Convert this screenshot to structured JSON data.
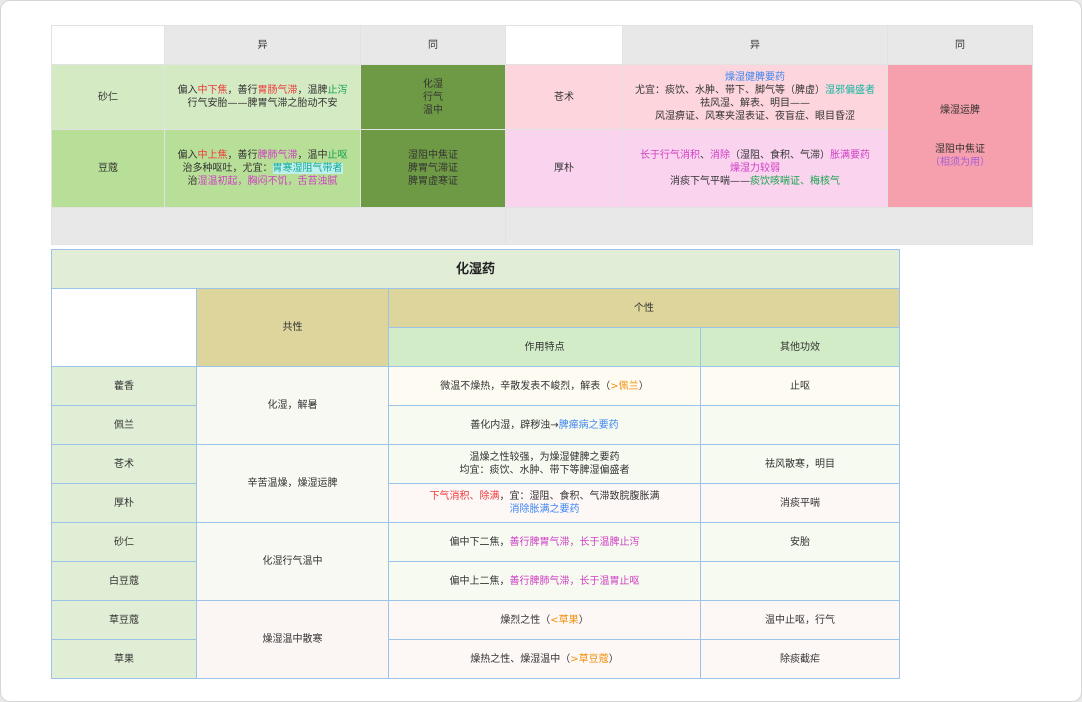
{
  "compare": {
    "header": {
      "yi": "异",
      "tong": "同"
    },
    "left": {
      "row1": {
        "name": "砂仁",
        "l1": [
          "偏入",
          "中下焦",
          "，善行",
          "胃肠气滞",
          "，温脾",
          "止泻"
        ],
        "l2": "行气安胎——脾胃气滞之胎动不安"
      },
      "row2": {
        "name": "豆蔻",
        "l1": [
          "偏入",
          "中上焦",
          "，善行",
          "脾肺气滞",
          "，温中",
          "止呕"
        ],
        "l2": [
          "治多种呕吐，尤宜：",
          "胃寒湿阻气带者"
        ],
        "l3": [
          "治",
          "湿温初起，胸闷不饥，舌苔浊腻"
        ]
      },
      "same1": [
        "化湿",
        "行气",
        "温中"
      ],
      "same2": [
        "湿阻中焦证",
        "脾胃气滞证",
        "脾胃虚寒证"
      ]
    },
    "right": {
      "row1": {
        "name": "苍术",
        "l1": "燥湿健脾要药",
        "l2": [
          "尤宜：痰饮、水肿、带下、脚气等（脾虚）",
          "湿邪偏盛者"
        ],
        "l3": "祛风湿、解表、明目——",
        "l4": "风湿痹证、风寒夹湿表证、夜盲症、眼目昏涩"
      },
      "row2": {
        "name": "厚朴",
        "l1": [
          "长于行气消积",
          "、",
          "消除",
          "（湿阻、食积、气滞）",
          "胀满要药"
        ],
        "l2": "燥湿力较弱",
        "l3": [
          "消痰下气平喘——",
          "痰饮咳喘证、梅核气"
        ]
      },
      "same1": "燥湿运脾",
      "same2": "湿阻中焦证",
      "same2b": "（相须为用）"
    }
  },
  "main": {
    "title": "化湿药",
    "h_common": "共性",
    "h_individual": "个性",
    "h_feature": "作用特点",
    "h_other": "其他功效",
    "rows": [
      {
        "name": "藿香",
        "feature": [
          "微温不燥热，辛散发表不峻烈，解表（",
          ">佩兰",
          "）"
        ],
        "other": "止呕"
      },
      {
        "name": "佩兰",
        "feature": [
          "善化内湿，辟秽浊→",
          "脾瘅病之要药"
        ],
        "other": ""
      },
      {
        "name": "苍术",
        "feature": [
          "温燥之性较强，为燥湿健脾之要药",
          "均宜：痰饮、水肿、带下等脾湿偏盛者"
        ],
        "other": "祛风散寒，明目"
      },
      {
        "name": "厚朴",
        "feature": [
          "下气消积、除满",
          "，宜：湿阻、食积、气滞致脘腹胀满",
          "消除胀满之要药"
        ],
        "other": "消痰平喘"
      },
      {
        "name": "砂仁",
        "feature": [
          "偏中下二焦，",
          "善行脾胃气滞，长于温脾止泻"
        ],
        "other": "安胎"
      },
      {
        "name": "白豆蔻",
        "feature": [
          "偏中上二焦，",
          "善行脾肺气滞，长于温胃止呕"
        ],
        "other": ""
      },
      {
        "name": "草豆蔻",
        "feature": [
          "燥烈之性（",
          "<草果",
          "）"
        ],
        "other": "温中止呕，行气"
      },
      {
        "name": "草果",
        "feature": [
          "燥热之性、燥湿温中（",
          ">草豆蔻",
          "）"
        ],
        "other": "除痰截疟"
      }
    ],
    "common": [
      "化湿，解暑",
      "辛苦温燥，燥湿运脾",
      "化湿行气温中",
      "燥湿温中散寒"
    ]
  },
  "colors": {
    "green_light": "#d3eac3",
    "green_mid": "#b8df98",
    "green_dark": "#6f9a45",
    "pink": "#fdd5dd",
    "pink_light": "#fad3ef",
    "pink_dark": "#f7a0ad",
    "olive": "#ddd59b",
    "mint": "#d1ecc6"
  }
}
